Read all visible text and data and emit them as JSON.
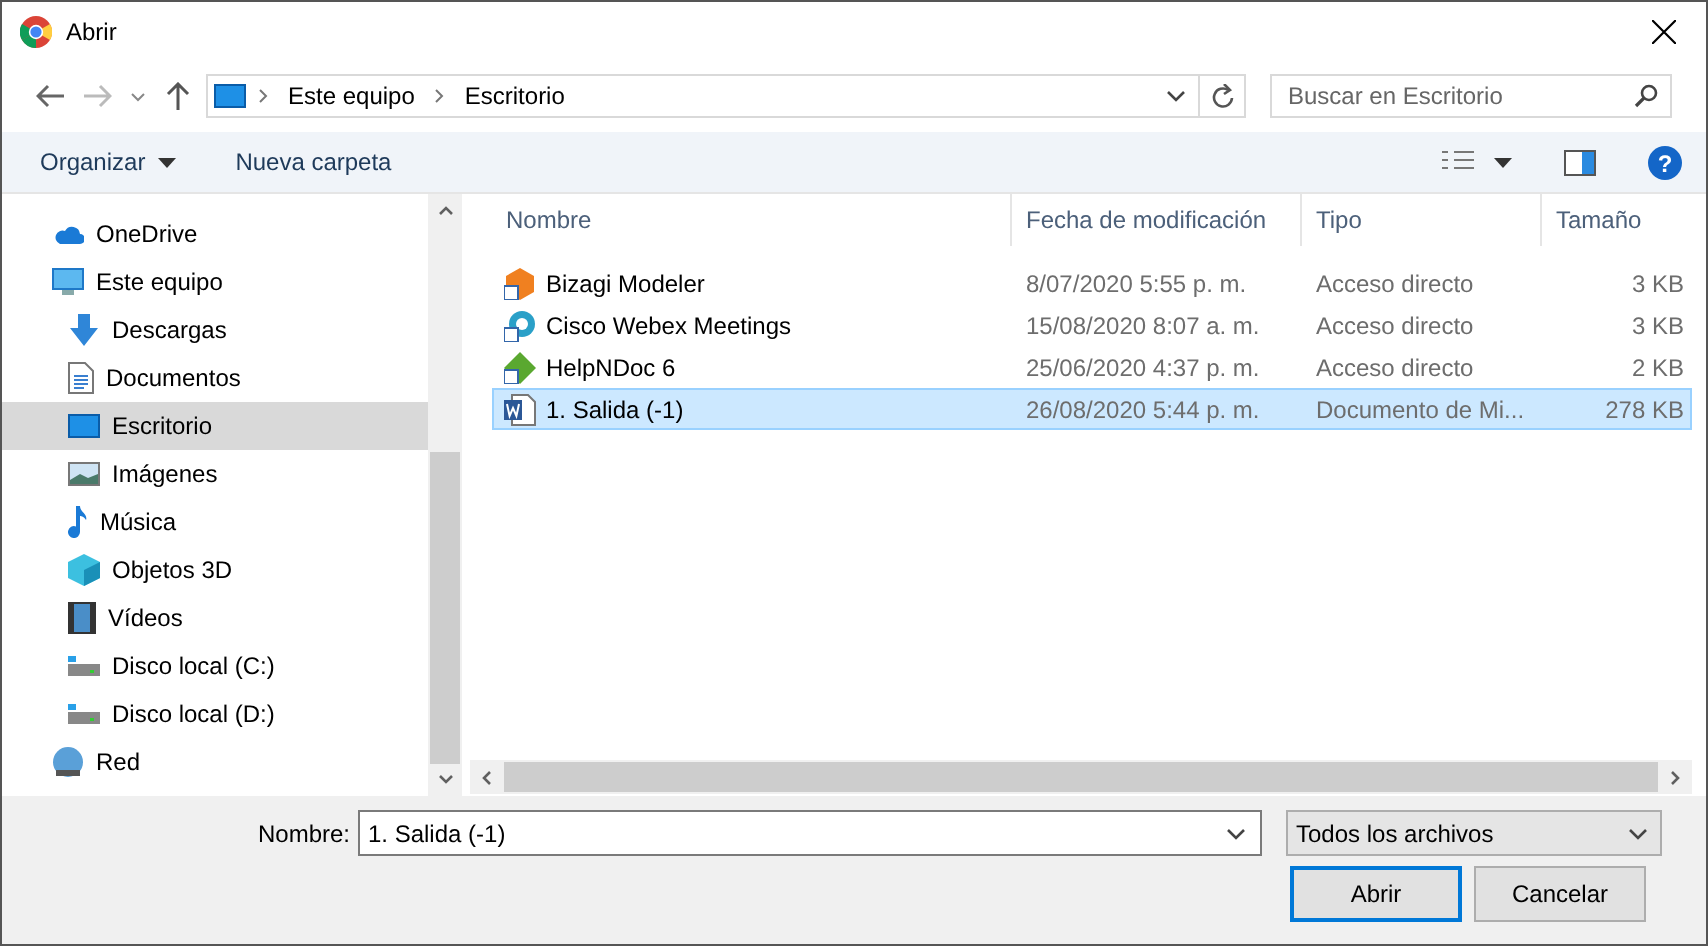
{
  "window": {
    "title": "Abrir"
  },
  "address": {
    "crumbs": [
      "Este equipo",
      "Escritorio"
    ]
  },
  "search": {
    "placeholder": "Buscar en Escritorio"
  },
  "toolbar": {
    "buttons": [
      "Organizar",
      "Nueva carpeta"
    ],
    "help": "?"
  },
  "nav_pane": {
    "items": [
      {
        "label": "OneDrive",
        "kind": "cloud",
        "selected": false
      },
      {
        "label": "Este equipo",
        "kind": "pc",
        "selected": false,
        "children": [
          {
            "label": "Descargas",
            "kind": "download",
            "selected": false
          },
          {
            "label": "Documentos",
            "kind": "document",
            "selected": false
          },
          {
            "label": "Escritorio",
            "kind": "desktop",
            "selected": true
          },
          {
            "label": "Imágenes",
            "kind": "pictures",
            "selected": false
          },
          {
            "label": "Música",
            "kind": "music",
            "selected": false
          },
          {
            "label": "Objetos 3D",
            "kind": "cube",
            "selected": false
          },
          {
            "label": "Vídeos",
            "kind": "video",
            "selected": false
          },
          {
            "label": "Disco local (C:)",
            "kind": "drive",
            "selected": false
          },
          {
            "label": "Disco local (D:)",
            "kind": "drive",
            "selected": false
          }
        ]
      },
      {
        "label": "Red",
        "kind": "network",
        "selected": false
      }
    ]
  },
  "file_list": {
    "columns": [
      "Nombre",
      "Fecha de modificación",
      "Tipo",
      "Tamaño"
    ],
    "rows": [
      {
        "name": "Bizagi Modeler",
        "date": "8/07/2020 5:55 p. m.",
        "type": "Acceso directo",
        "size": "3 KB",
        "kind": "shortcut-orange",
        "selected": false
      },
      {
        "name": "Cisco Webex Meetings",
        "date": "15/08/2020 8:07 a. m.",
        "type": "Acceso directo",
        "size": "3 KB",
        "kind": "shortcut-globe",
        "selected": false
      },
      {
        "name": "HelpNDoc 6",
        "date": "25/06/2020 4:37 p. m.",
        "type": "Acceso directo",
        "size": "2 KB",
        "kind": "shortcut-green",
        "selected": false
      },
      {
        "name": "1. Salida (-1)",
        "date": "26/08/2020 5:44 p. m.",
        "type": "Documento de Mi...",
        "size": "278 KB",
        "kind": "word",
        "selected": true
      }
    ]
  },
  "footer": {
    "name_label": "Nombre:",
    "name_value": "1. Salida (-1)",
    "filter": "Todos los archivos",
    "buttons": [
      "Abrir",
      "Cancelar"
    ]
  }
}
